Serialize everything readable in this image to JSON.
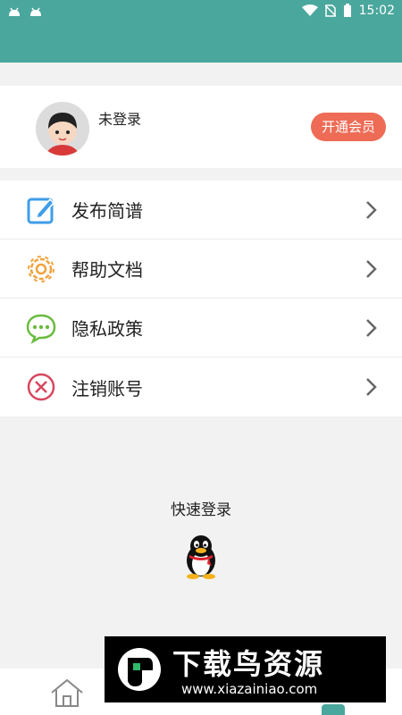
{
  "status_bar": {
    "time": "15:02"
  },
  "profile": {
    "login_status": "未登录",
    "vip_button": "开通会员"
  },
  "menu": {
    "items": [
      {
        "label": "发布简谱",
        "icon": "edit-icon",
        "color": "#3f9ee8"
      },
      {
        "label": "帮助文档",
        "icon": "gear-icon",
        "color": "#f0a23b"
      },
      {
        "label": "隐私政策",
        "icon": "chat-bubble-icon",
        "color": "#6abb3f"
      },
      {
        "label": "注销账号",
        "icon": "cancel-circle-icon",
        "color": "#d6485f"
      }
    ]
  },
  "quick_login": {
    "title": "快速登录",
    "icon": "qq-penguin-icon"
  },
  "watermark": {
    "title": "下载鸟资源",
    "url": "www.xiazainiao.com"
  },
  "colors": {
    "accent": "#4aa79d",
    "vip": "#ee6b55"
  }
}
